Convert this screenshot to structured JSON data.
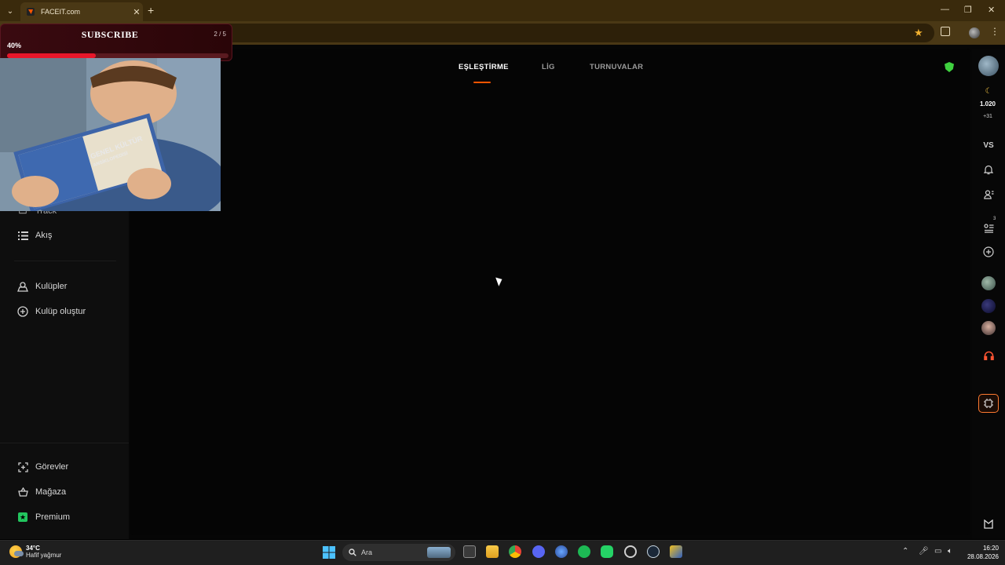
{
  "browser": {
    "tab_title": "FACEIT.com",
    "tab_close": "✕",
    "new_tab": "+",
    "tab_menu": "⌄",
    "window_controls": [
      "—",
      "❐",
      "✕"
    ]
  },
  "overlay": {
    "title": "SUBSCRIBE",
    "counter": "2 / 5",
    "percent_label": "40%",
    "progress": 0.4
  },
  "video": {
    "book_title": "GENEL KÜLTÜR",
    "book_subtitle": "ANSİKLOPEDİSİ"
  },
  "topnav": {
    "items": [
      "EŞLEŞTİRME",
      "LİG",
      "TURNUVALAR"
    ],
    "active": "EŞLEŞTİRME"
  },
  "sidebar": {
    "partial_item": "Track",
    "items": [
      {
        "label": "Akış",
        "icon": "list-icon"
      },
      {
        "label": "Kulüpler",
        "icon": "clubs-icon"
      },
      {
        "label": "Kulüp oluştur",
        "icon": "plus-circle-icon"
      }
    ],
    "bottom_items": [
      {
        "label": "Görevler",
        "icon": "missions-icon"
      },
      {
        "label": "Mağaza",
        "icon": "basket-icon"
      },
      {
        "label": "Premium",
        "icon": "premium-star-icon"
      }
    ]
  },
  "rightbar": {
    "elo": "1.020",
    "elo_change": "+31",
    "vs_label": "VS",
    "party_badge": "3"
  },
  "taskbar": {
    "weather_temp": "34°C",
    "weather_desc": "Hafif yağmur",
    "search_placeholder": "Ara",
    "time": "16:20",
    "date": "28.08.2026"
  },
  "colors": {
    "accent": "#ff5500",
    "premium": "#22c55e",
    "shield": "#3fd13f",
    "progress_fill": "#e8162a"
  }
}
